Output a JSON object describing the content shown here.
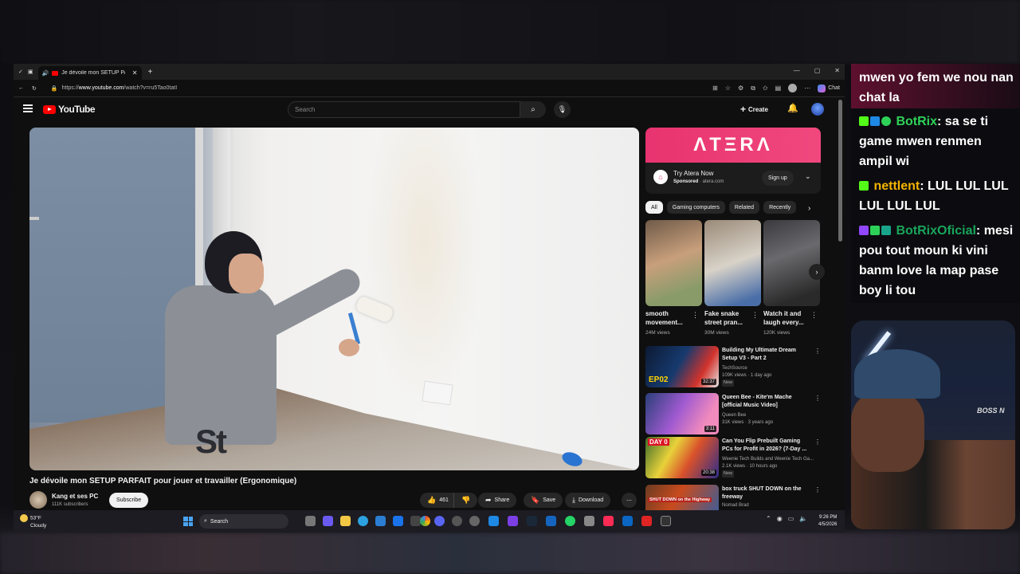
{
  "browser": {
    "tab_title": "Je dévoile mon SETUP PARFAIT",
    "url_prefix": "https://",
    "url_host": "www.youtube.com",
    "url_path": "/watch?v=ru5Tao0tatI",
    "chat_label": "Chat"
  },
  "youtube": {
    "logo_text": "YouTube",
    "search_placeholder": "Search",
    "create_label": "Create",
    "video": {
      "title": "Je dévoile mon SETUP PARFAIT pour jouer et travailler (Ergonomique)",
      "shirt_text": "St"
    },
    "channel": {
      "name": "Kang et ses PC",
      "subscribers": "111K subscribers",
      "subscribe_label": "Subscribe"
    },
    "actions": {
      "likes": "461",
      "share": "Share",
      "save": "Save",
      "download": "Download"
    },
    "ad": {
      "banner": "ΛTΞRΛ",
      "title": "Try Atera Now",
      "sponsored": "Sponsored",
      "domain": "· atera.com",
      "signup": "Sign up"
    },
    "chips": [
      "All",
      "Gaming computers",
      "Related",
      "Recently"
    ],
    "shorts": [
      {
        "title": "smooth movement...",
        "views": "24M views"
      },
      {
        "title": "Fake snake street pran...",
        "views": "30M views"
      },
      {
        "title": "Watch it and laugh every...",
        "views": "120K views"
      }
    ],
    "recommended": [
      {
        "title": "Building My Ultimate Dream Setup V3 - Part 2",
        "channel": "TechSource",
        "meta": "109K views · 1 day ago",
        "tag": "New",
        "duration": "32:37",
        "thumb_text": "EP02"
      },
      {
        "title": "Queen Bee - Kite'm Mache [official Music Video]",
        "channel": "Queen Bee",
        "meta": "31K views · 3 years ago",
        "tag": "",
        "duration": "3:11",
        "thumb_text": ""
      },
      {
        "title": "Can You Flip Prebuilt Gaming PCs for Profit in 2026? (7-Day ...",
        "channel": "Weenie Tech Builds and Weenie Tech Ga...",
        "meta": "2.1K views · 10 hours ago",
        "tag": "New",
        "duration": "20:38",
        "thumb_text": "DAY 0"
      },
      {
        "title": "box truck SHUT DOWN on the freeway",
        "channel": "Nomad Brad",
        "meta": "",
        "tag": "",
        "duration": "",
        "thumb_text": "SHUT DOWN on the Highway"
      }
    ]
  },
  "taskbar": {
    "temp": "53°F",
    "condition": "Cloudy",
    "search": "Search",
    "time": "9:26 PM",
    "date": "4/5/2026"
  },
  "chat": {
    "messages": [
      {
        "user": "",
        "text": "mwen yo fem we nou nan chat la"
      },
      {
        "user": "BotRix",
        "text": ": sa se ti game mwen renmen ampil wi"
      },
      {
        "user": "nettlent",
        "text": ": LUL LUL LUL LUL LUL LUL"
      },
      {
        "user": "BotRixOficial",
        "text": ": mesi pou tout moun ki vini banm love la map pase boy li tou"
      }
    ]
  },
  "webcam": {
    "shirt_text": "BOSS N"
  },
  "colors": {
    "youtube_red": "#ff0000",
    "atera_pink": "#e8336f",
    "botrix_green": "#2ed158",
    "nettlent_yellow": "#f2b400"
  }
}
